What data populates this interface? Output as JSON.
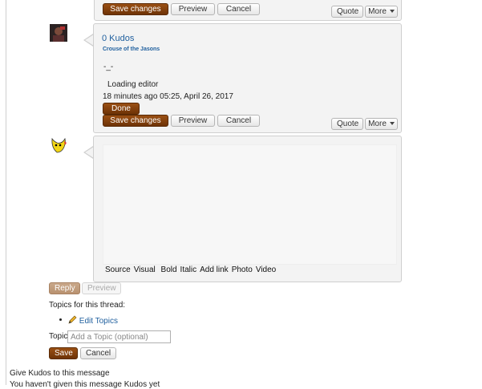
{
  "post_top": {
    "save_label": "Save changes",
    "preview_label": "Preview",
    "cancel_label": "Cancel",
    "quote_label": "Quote",
    "more_label": "More"
  },
  "post_second": {
    "kudos": "0 Kudos",
    "author": "Crouse of the Jasons",
    "body_mark": "-_-",
    "loading": "Loading editor",
    "timestamp": "18 minutes ago 05:25, April 26, 2017",
    "done_label": "Done",
    "save_label": "Save changes",
    "preview_label": "Preview",
    "cancel_label": "Cancel",
    "quote_label": "Quote",
    "more_label": "More"
  },
  "reply_editor": {
    "toolbar": [
      "Source",
      "Visual",
      "Bold",
      "Italic",
      "Add link",
      "Photo",
      "Video"
    ]
  },
  "reply_actions": {
    "reply_label": "Reply",
    "preview_label": "Preview"
  },
  "topics": {
    "heading": "Topics for this thread:",
    "edit_label": "Edit Topics",
    "field_label": "Topic",
    "placeholder": "Add a Topic (optional)",
    "save_label": "Save",
    "cancel_label": "Cancel"
  },
  "footer": {
    "give_kudos": "Give Kudos to this message",
    "partial": "You haven't given this message Kudos yet"
  },
  "colors": {
    "brown_button": "#7a3b0a",
    "link": "#1f5f9e",
    "panel": "#f3f3f3"
  }
}
